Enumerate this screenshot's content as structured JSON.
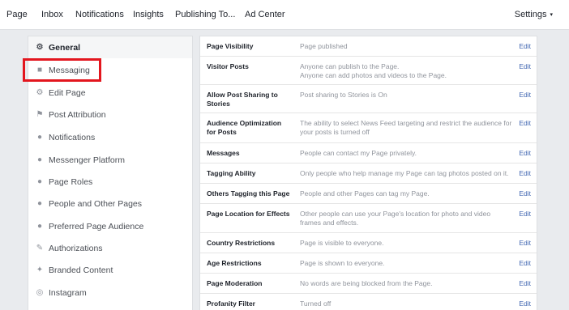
{
  "topnav": {
    "items": [
      "Page",
      "Inbox",
      "Notifications",
      "Insights",
      "Publishing To...",
      "Ad Center"
    ],
    "settings": "Settings",
    "caret": "▾"
  },
  "sidebar": {
    "items": [
      {
        "label": "General",
        "icon": "gear-icon",
        "glyph": "⚙"
      },
      {
        "label": "Messaging",
        "icon": "chat-bubbles-icon",
        "glyph": "■"
      },
      {
        "label": "Edit Page",
        "icon": "gear-icon",
        "glyph": "⚙"
      },
      {
        "label": "Post Attribution",
        "icon": "flag-icon",
        "glyph": "⚑"
      },
      {
        "label": "Notifications",
        "icon": "globe-icon",
        "glyph": "●"
      },
      {
        "label": "Messenger Platform",
        "icon": "messenger-icon",
        "glyph": "●"
      },
      {
        "label": "Page Roles",
        "icon": "person-icon",
        "glyph": "●"
      },
      {
        "label": "People and Other Pages",
        "icon": "person-plus-icon",
        "glyph": "●"
      },
      {
        "label": "Preferred Page Audience",
        "icon": "person-plus-icon",
        "glyph": "●"
      },
      {
        "label": "Authorizations",
        "icon": "wrench-icon",
        "glyph": "✎"
      },
      {
        "label": "Branded Content",
        "icon": "handshake-icon",
        "glyph": "✦"
      },
      {
        "label": "Instagram",
        "icon": "instagram-icon",
        "glyph": "◎"
      }
    ]
  },
  "settings": {
    "edit_label": "Edit",
    "rows": [
      {
        "label": "Page Visibility",
        "value": [
          "Page published"
        ]
      },
      {
        "label": "Visitor Posts",
        "value": [
          "Anyone can publish to the Page.",
          "Anyone can add photos and videos to the Page."
        ]
      },
      {
        "label": "Allow Post Sharing to Stories",
        "value": [
          "Post sharing to Stories is On"
        ]
      },
      {
        "label": "Audience Optimization for Posts",
        "value": [
          "The ability to select News Feed targeting and restrict the audience for your posts is turned off"
        ]
      },
      {
        "label": "Messages",
        "value": [
          "People can contact my Page privately."
        ]
      },
      {
        "label": "Tagging Ability",
        "value": [
          "Only people who help manage my Page can tag photos posted on it."
        ]
      },
      {
        "label": "Others Tagging this Page",
        "value": [
          "People and other Pages can tag my Page."
        ]
      },
      {
        "label": "Page Location for Effects",
        "value": [
          "Other people can use your Page's location for photo and video frames and effects."
        ]
      },
      {
        "label": "Country Restrictions",
        "value": [
          "Page is visible to everyone."
        ]
      },
      {
        "label": "Age Restrictions",
        "value": [
          "Page is shown to everyone."
        ]
      },
      {
        "label": "Page Moderation",
        "value": [
          "No words are being blocked from the Page."
        ]
      },
      {
        "label": "Profanity Filter",
        "value": [
          "Turned off"
        ]
      }
    ]
  },
  "colors": {
    "accent_link": "#4267b2",
    "highlight_box": "#e3161e",
    "background": "#e9ebee"
  }
}
